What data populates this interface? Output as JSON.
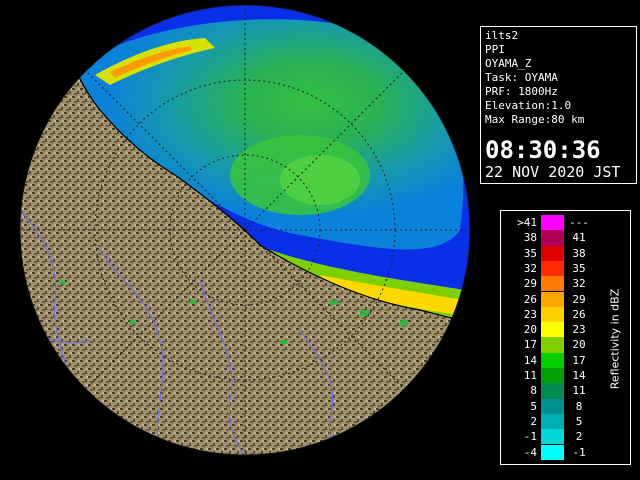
{
  "info": {
    "line1": "ilts2",
    "line2": "PPI",
    "line3": "OYAMA_Z",
    "line4": "Task: OYAMA",
    "line5": "PRF: 1800Hz",
    "line6": "Elevation:1.0",
    "line7": "Max Range:80 km",
    "time": "08:30:36",
    "date": "22 NOV 2020 JST"
  },
  "legend": {
    "title": "Reflectivity in dBZ",
    "rows": [
      {
        "lo": ">41",
        "hi": "---",
        "color": "#ff00ff"
      },
      {
        "lo": "38",
        "hi": "41",
        "color": "#b0005a"
      },
      {
        "lo": "35",
        "hi": "38",
        "color": "#e00000"
      },
      {
        "lo": "32",
        "hi": "35",
        "color": "#ff2a00"
      },
      {
        "lo": "29",
        "hi": "32",
        "color": "#ff7a00"
      },
      {
        "lo": "26",
        "hi": "29",
        "color": "#ffa500"
      },
      {
        "lo": "23",
        "hi": "26",
        "color": "#ffd000"
      },
      {
        "lo": "20",
        "hi": "23",
        "color": "#ffff00"
      },
      {
        "lo": "17",
        "hi": "20",
        "color": "#80d000"
      },
      {
        "lo": "14",
        "hi": "17",
        "color": "#00d000"
      },
      {
        "lo": "11",
        "hi": "14",
        "color": "#00a000"
      },
      {
        "lo": "8",
        "hi": "11",
        "color": "#008c50"
      },
      {
        "lo": "5",
        "hi": "8",
        "color": "#009090"
      },
      {
        "lo": "2",
        "hi": "5",
        "color": "#00b0b0"
      },
      {
        "lo": "-1",
        "hi": "2",
        "color": "#00d8d8"
      },
      {
        "lo": "-4",
        "hi": "-1",
        "color": "#00ffff"
      }
    ]
  },
  "colors": {
    "sea": "#0a2fe8",
    "land": "#a0936c",
    "land_dark": "#3a2e22",
    "rivers": "#6a6aff",
    "boundaries": "#d04040",
    "echo_low": "#00c8c8",
    "echo_mid": "#00b000",
    "echo_high": "#ffff00"
  }
}
